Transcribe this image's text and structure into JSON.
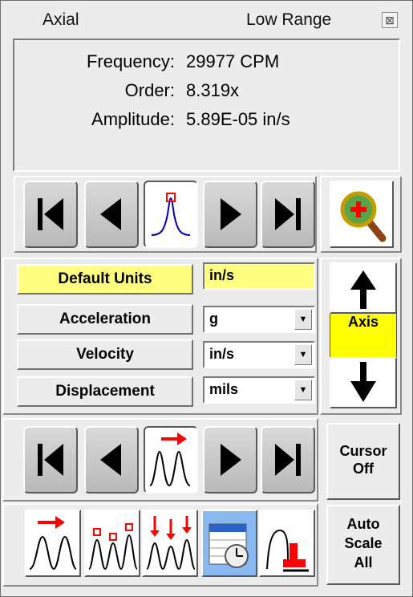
{
  "window": {
    "title_left": "Axial",
    "title_right": "Low Range",
    "close_glyph": "⊠"
  },
  "readout": {
    "frequency_label": "Frequency:",
    "frequency_value": "29977 CPM",
    "order_label": "Order:",
    "order_value": "8.319x",
    "amplitude_label": "Amplitude:",
    "amplitude_value": "5.89E-05 in/s"
  },
  "peak_nav": {
    "icons": [
      "skip-to-first-icon",
      "step-back-icon",
      "peak-marker-icon",
      "step-forward-icon",
      "skip-to-last-icon"
    ]
  },
  "zoom": {
    "icon": "zoom-magnifier-icon"
  },
  "units": {
    "default_label": "Default Units",
    "default_value": "in/s",
    "rows": [
      {
        "label": "Acceleration",
        "value": "g"
      },
      {
        "label": "Velocity",
        "value": "in/s"
      },
      {
        "label": "Displacement",
        "value": "mils"
      }
    ]
  },
  "axis": {
    "label": "Axis",
    "up_icon": "arrow-up-icon",
    "down_icon": "arrow-down-icon"
  },
  "cursor_nav": {
    "icons": [
      "skip-to-first-icon",
      "step-back-icon",
      "harmonic-cursor-icon",
      "step-forward-icon",
      "skip-to-last-icon"
    ],
    "cursor_off_label_line1": "Cursor",
    "cursor_off_label_line2": "Off"
  },
  "tools": {
    "icons": [
      "single-cursor-icon",
      "peak-labels-icon",
      "harmonic-markers-icon",
      "time-waveform-icon",
      "stamp-icon"
    ],
    "autoscale_line1": "Auto",
    "autoscale_line2": "Scale",
    "autoscale_line3": "All"
  },
  "colors": {
    "highlight_yellow": "#ffff80",
    "axis_yellow": "#ffff00",
    "marker_red": "#ff0000",
    "peak_blue": "#0000aa"
  }
}
